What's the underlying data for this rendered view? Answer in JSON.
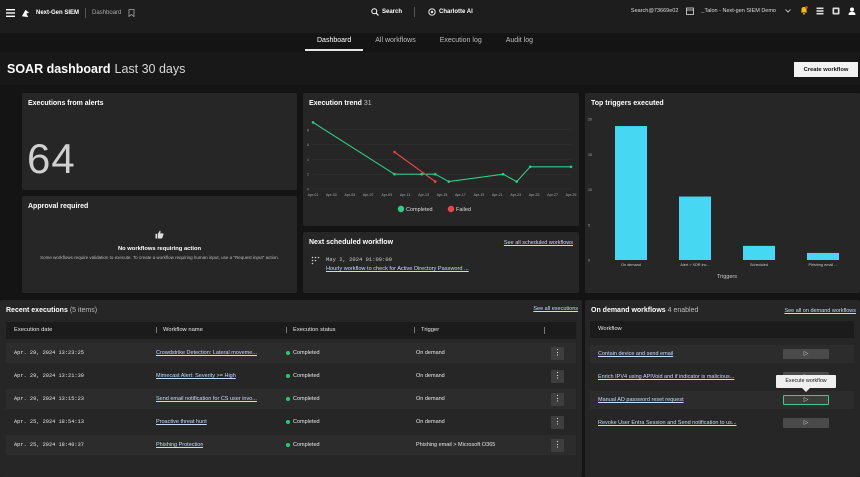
{
  "topbar": {
    "brand": "Next-Gen SIEM",
    "section": "Dashboard",
    "search_label": "Search",
    "charlotte_label": "Charlotte AI",
    "account_text": "Search@73669e02",
    "tenant_text": "_Talon - Next-gen SIEM Demo"
  },
  "tabs": [
    "Dashboard",
    "All workflows",
    "Execution log",
    "Audit log"
  ],
  "page": {
    "title": "SOAR dashboard",
    "range": "Last 30 days",
    "create_button": "Create workflow"
  },
  "executions_from_alerts": {
    "title": "Executions from alerts",
    "value": "64"
  },
  "approval": {
    "title": "Approval required",
    "heading": "No workflows requiring action",
    "description": "Some workflows require validation to execute. To create a workflow requiring human input, use a \"Request input\" action."
  },
  "trend": {
    "title": "Execution trend",
    "count": "31"
  },
  "scheduled": {
    "title": "Next scheduled workflow",
    "see_all": "See all scheduled workflows",
    "date": "May 2, 2024 01:00:00",
    "name": "Hourly workflow to check for Active Directory Password ..."
  },
  "triggers": {
    "title": "Top triggers executed"
  },
  "recent": {
    "title": "Recent executions",
    "count": "(5 items)",
    "see_all": "See all executions",
    "columns": [
      "Execution date",
      "Workflow name",
      "Execution status",
      "Trigger"
    ],
    "rows": [
      {
        "date": "Apr. 29, 2024 13:23:25",
        "name": "Crowdstrike Detection: Lateral moveme...",
        "status": "Completed",
        "trigger": "On demand"
      },
      {
        "date": "Apr. 29, 2024 13:21:30",
        "name": "Mimecast Alert: Severity >= High",
        "status": "Completed",
        "trigger": "On demand"
      },
      {
        "date": "Apr. 29, 2024 13:15:23",
        "name": "Send email notification for CS user invo...",
        "status": "Completed",
        "trigger": "On demand"
      },
      {
        "date": "Apr. 25, 2024 18:54:13",
        "name": "Proactive threat hunt",
        "status": "Completed",
        "trigger": "On demand"
      },
      {
        "date": "Apr. 25, 2024 18:40:37",
        "name": "Phishing Protection",
        "status": "Completed",
        "trigger": "Phishing email > Microsoft O365"
      }
    ]
  },
  "ondemand": {
    "title": "On demand workflows",
    "count": "4 enabled",
    "see_all": "See all on demand workflows",
    "column": "Workflow",
    "rows": [
      "Contain device and send email",
      "Enrich IPV4 using APIVoid and if indicator is malicious...",
      "Manual AD password reset request",
      "Revoke User Entra Session and Send notification to us..."
    ],
    "tooltip": "Execute workflow"
  },
  "colors": {
    "completed": "#2ecc8a",
    "failed": "#ef4444",
    "bar": "#46d7f2"
  },
  "chart_data": [
    {
      "type": "line",
      "title": "Execution trend",
      "x": [
        "Apr-01",
        "Apr-03",
        "Apr-05",
        "Apr-07",
        "Apr-09",
        "Apr-11",
        "Apr-13",
        "Apr-15",
        "Apr-17",
        "Apr-19",
        "Apr-21",
        "Apr-23",
        "Apr-25",
        "Apr-27",
        "Apr-29"
      ],
      "ylim": [
        0,
        10
      ],
      "yticks": [
        0,
        2,
        4,
        6,
        8
      ],
      "series": [
        {
          "name": "Completed",
          "color": "#2ecc8a",
          "points": [
            [
              0,
              9
            ],
            [
              6,
              2
            ],
            [
              8,
              2
            ],
            [
              9,
              2
            ],
            [
              10,
              1
            ],
            [
              14,
              2
            ],
            [
              15,
              1
            ],
            [
              16,
              3
            ],
            [
              19,
              3
            ]
          ]
        },
        {
          "name": "Failed",
          "color": "#ef4444",
          "points": [
            [
              6,
              5
            ],
            [
              9,
              1
            ]
          ]
        }
      ],
      "legend": "bottom"
    },
    {
      "type": "bar",
      "title": "Top triggers executed",
      "xlabel": "Triggers",
      "categories": [
        "On demand",
        "Alert > XDR inc...",
        "Scheduled",
        "Phishing email ..."
      ],
      "values": [
        19,
        9,
        2,
        1
      ],
      "ylim": [
        0,
        20
      ],
      "yticks": [
        0,
        5,
        10,
        15,
        20
      ]
    }
  ]
}
